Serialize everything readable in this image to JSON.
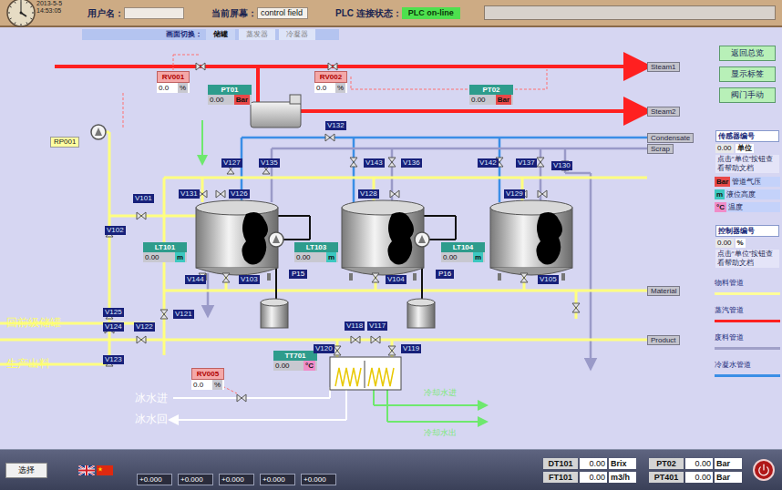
{
  "header": {
    "datetime": "2013-5-5 14:53:05",
    "user_label": "用户名：",
    "user_value": "",
    "screen_label": "当前屏幕：",
    "screen_value": "control field",
    "plc_label": "PLC 连接状态：",
    "plc_value": "PLC on-line",
    "plc_online": true
  },
  "nav": {
    "label": "画面切换：",
    "tabs": [
      {
        "label": "储罐",
        "selected": true
      },
      {
        "label": "蒸发器",
        "selected": false
      },
      {
        "label": "冷凝器",
        "selected": false
      }
    ]
  },
  "lines": [
    "Steam1",
    "Steam2",
    "Condensate",
    "Scrap",
    "Material",
    "Product"
  ],
  "controllers": [
    {
      "name": "RV001",
      "value": "0.0",
      "unit": "%"
    },
    {
      "name": "RV002",
      "value": "0.0",
      "unit": "%"
    },
    {
      "name": "RV005",
      "value": "0.0",
      "unit": "%"
    }
  ],
  "sensors": [
    {
      "name": "PT01",
      "value": "0.00",
      "unit": "Bar",
      "unit_color": "#e84848"
    },
    {
      "name": "PT02",
      "value": "0.00",
      "unit": "Bar",
      "unit_color": "#e84848"
    },
    {
      "name": "LT101",
      "value": "0.00",
      "unit": "m",
      "unit_color": "#3cc8c0"
    },
    {
      "name": "LT103",
      "value": "0.00",
      "unit": "m",
      "unit_color": "#3cc8c0"
    },
    {
      "name": "LT104",
      "value": "0.00",
      "unit": "m",
      "unit_color": "#3cc8c0"
    },
    {
      "name": "TT701",
      "value": "0.00",
      "unit": "°C",
      "unit_color": "#f08cc8"
    }
  ],
  "pumps": [
    "RP001",
    "P15",
    "P16"
  ],
  "valves": [
    "V132",
    "V127",
    "V135",
    "V143",
    "V136",
    "V142",
    "V137",
    "V130",
    "V131",
    "V126",
    "V128",
    "V129",
    "V101",
    "V102",
    "V144",
    "V103",
    "V104",
    "V105",
    "V125",
    "V121",
    "V124",
    "V122",
    "V123",
    "V118",
    "V117",
    "V120",
    "V119"
  ],
  "side_labels": [
    {
      "text": "回前级储罐",
      "color": "#ffff66"
    },
    {
      "text": "生产出料",
      "color": "#ffff66"
    },
    {
      "text": "冰水进",
      "color": "#ffffff"
    },
    {
      "text": "冰水回",
      "color": "#ffffff"
    },
    {
      "text": "冷却水进",
      "color": "#7ee87e"
    },
    {
      "text": "冷却水出",
      "color": "#7ee87e"
    }
  ],
  "panel": {
    "buttons": [
      "返回总览",
      "显示标签",
      "阀门手动"
    ],
    "sensor_legend": {
      "title": "传感器编号",
      "value": "0.00",
      "unit": "单位",
      "help": "点击“单位”按钮查看帮助文档"
    },
    "units": [
      {
        "unit": "Bar",
        "meaning": "管道气压",
        "color": "#e84848"
      },
      {
        "unit": "m",
        "meaning": "液位高度",
        "color": "#3cc8c0"
      },
      {
        "unit": "°C",
        "meaning": "温度",
        "color": "#f08cc8"
      }
    ],
    "controller_legend": {
      "title": "控制器编号",
      "value": "0.00",
      "unit": "%",
      "help": "点击“单位”按钮查看帮助文档"
    },
    "pipes": [
      {
        "label": "物料管道",
        "color": "#ffff99"
      },
      {
        "label": "蒸汽管道",
        "color": "#ff2020"
      },
      {
        "label": "废料管道",
        "color": "#a0a0c8"
      },
      {
        "label": "冷凝水管道",
        "color": "#3a8ee6"
      }
    ]
  },
  "bottom": {
    "select": "选择",
    "fields": [
      "+0.000",
      "+0.000",
      "+0.000",
      "+0.000",
      "+0.000"
    ],
    "readouts": [
      {
        "name": "DT101",
        "value": "0.00",
        "unit": "Brix"
      },
      {
        "name": "FT101",
        "value": "0.00",
        "unit": "m3/h"
      },
      {
        "name": "PT02",
        "value": "0.00",
        "unit": "Bar"
      },
      {
        "name": "PT401",
        "value": "0.00",
        "unit": "Bar"
      }
    ]
  }
}
